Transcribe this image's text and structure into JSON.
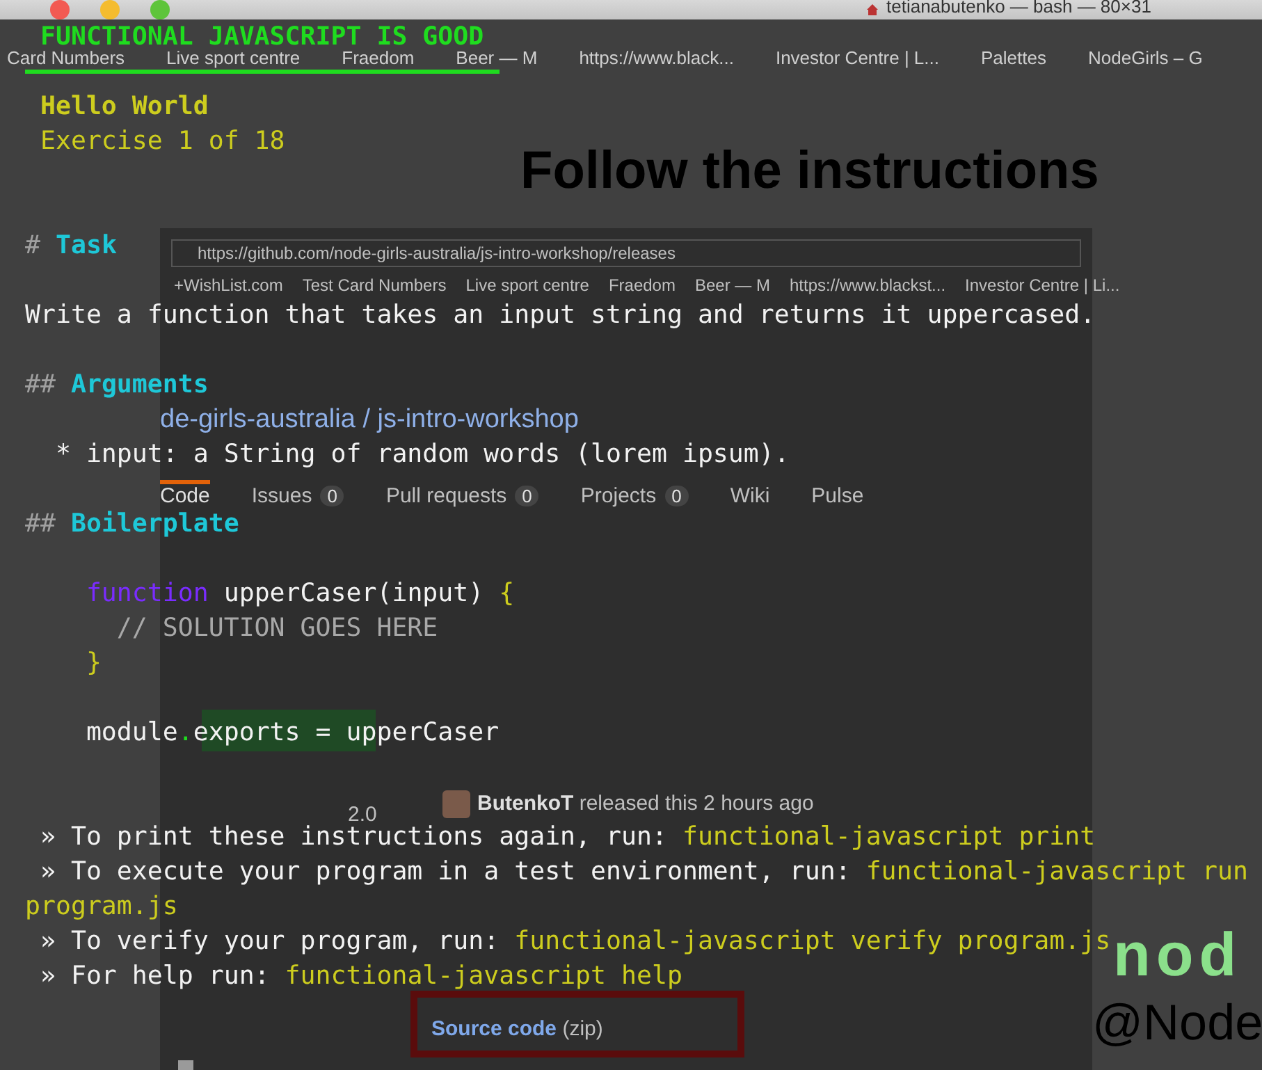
{
  "title_bar": {
    "title": "tetianabutenko — bash — 80×31"
  },
  "browser": {
    "bookmarks": [
      "Card Numbers",
      "Live sport centre",
      "Fraedom",
      "Beer — M",
      "https://www.black...",
      "Investor Centre | L...",
      "Palettes",
      "NodeGirls – G"
    ],
    "slide": {
      "heading": "Follow the instructions",
      "handle": "@Node",
      "logo": "nod"
    },
    "screenshot": {
      "url": "https://github.com/node-girls-australia/js-intro-workshop/releases",
      "bookmarks": [
        "+WishList.com",
        "Test Card Numbers",
        "Live sport centre",
        "Fraedom",
        "Beer — M",
        "https://www.blackst...",
        "Investor Centre | Li..."
      ],
      "repo": "de-girls-australia / js-intro-workshop",
      "tabs": [
        {
          "label": "Code",
          "selected": true
        },
        {
          "label": "Issues",
          "count": "0",
          "selected": false
        },
        {
          "label": "Pull requests",
          "count": "0",
          "selected": false
        },
        {
          "label": "Projects",
          "count": "0",
          "selected": false
        },
        {
          "label": "Wiki",
          "selected": false
        },
        {
          "label": "Pulse",
          "selected": false
        }
      ],
      "tag": "2.0",
      "release": "**ButenkoT** released this 2 hours ago",
      "asset": {
        "name": "Source code",
        "format": "(zip)"
      }
    }
  },
  "terminal": {
    "lines": [
      {
        "kind": "banner",
        "text": "FUNCTIONAL JAVASCRIPT IS GOOD"
      },
      {
        "kind": "text",
        "spans": [
          {
            "text": " Hello World",
            "kind": "title"
          }
        ]
      },
      {
        "kind": "text",
        "spans": [
          {
            "text": " Exercise 1 of 18",
            "kind": "subtitle"
          }
        ]
      },
      {
        "kind": "blank"
      },
      {
        "kind": "blank"
      },
      {
        "kind": "text",
        "spans": [
          {
            "text": "# ",
            "kind": "hash"
          },
          {
            "text": "Task",
            "kind": "section"
          }
        ]
      },
      {
        "kind": "blank"
      },
      {
        "kind": "text",
        "spans": [
          {
            "text": "Write a function that takes an input string and returns it uppercased.",
            "kind": "plain"
          }
        ]
      },
      {
        "kind": "blank"
      },
      {
        "kind": "text",
        "spans": [
          {
            "text": "## ",
            "kind": "hash"
          },
          {
            "text": "Arguments",
            "kind": "section"
          }
        ]
      },
      {
        "kind": "blank"
      },
      {
        "kind": "text",
        "spans": [
          {
            "text": "  * input: a String of random words (lorem ipsum).",
            "kind": "plain"
          }
        ]
      },
      {
        "kind": "blank"
      },
      {
        "kind": "text",
        "spans": [
          {
            "text": "## ",
            "kind": "hash"
          },
          {
            "text": "Boilerplate",
            "kind": "section"
          }
        ]
      },
      {
        "kind": "blank"
      },
      {
        "kind": "text",
        "spans": [
          {
            "text": "    function",
            "kind": "keyword"
          },
          {
            "text": " upperCaser(input) ",
            "kind": "plain"
          },
          {
            "text": "{",
            "kind": "punct"
          }
        ]
      },
      {
        "kind": "text",
        "spans": [
          {
            "text": "      // SOLUTION GOES HERE",
            "kind": "comment"
          }
        ]
      },
      {
        "kind": "text",
        "spans": [
          {
            "text": "    }",
            "kind": "punct"
          }
        ]
      },
      {
        "kind": "blank"
      },
      {
        "kind": "text",
        "spans": [
          {
            "text": "    module",
            "kind": "plain"
          },
          {
            "text": ".",
            "kind": "dot"
          },
          {
            "text": "exports = upperCaser",
            "kind": "plain"
          }
        ]
      },
      {
        "kind": "blank"
      },
      {
        "kind": "blank"
      },
      {
        "kind": "text",
        "spans": [
          {
            "text": " » To print these instructions again, run: ",
            "kind": "plain"
          },
          {
            "text": "functional-javascript print",
            "kind": "command"
          }
        ]
      },
      {
        "kind": "text",
        "spans": [
          {
            "text": " » To execute your program in a test environment, run: ",
            "kind": "plain"
          },
          {
            "text": "functional-javascript run",
            "kind": "command"
          }
        ]
      },
      {
        "kind": "text",
        "spans": [
          {
            "text": "program.js",
            "kind": "command"
          }
        ]
      },
      {
        "kind": "text",
        "spans": [
          {
            "text": " » To verify your program, run: ",
            "kind": "plain"
          },
          {
            "text": "functional-javascript verify program.js",
            "kind": "command"
          }
        ]
      },
      {
        "kind": "text",
        "spans": [
          {
            "text": " » For help run: ",
            "kind": "plain"
          },
          {
            "text": "functional-javascript help",
            "kind": "command"
          }
        ]
      },
      {
        "kind": "blank"
      },
      {
        "kind": "blank"
      },
      {
        "kind": "cursor"
      }
    ]
  }
}
